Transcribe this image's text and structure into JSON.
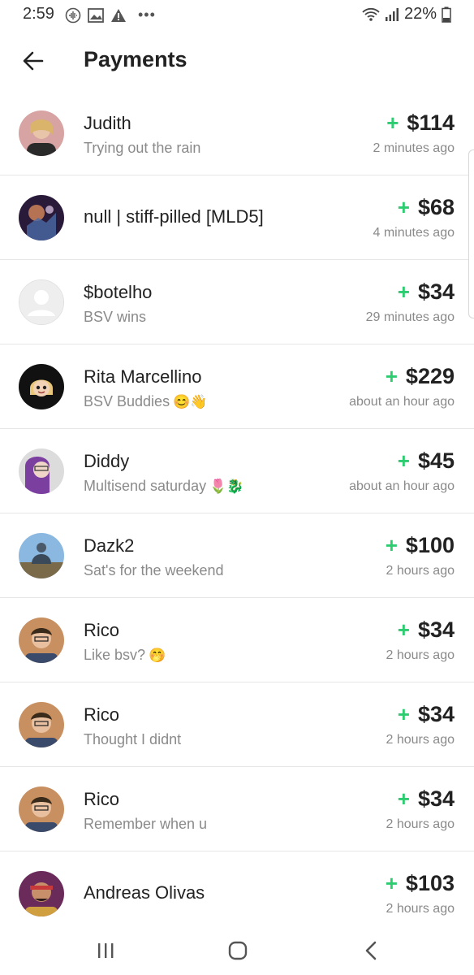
{
  "status": {
    "time": "2:59",
    "battery": "22%"
  },
  "header": {
    "title": "Payments"
  },
  "payments": [
    {
      "name": "Judith",
      "memo": "Trying out the rain",
      "amount": "$114",
      "time": "2 minutes ago",
      "avatar_color": "#c98a8a"
    },
    {
      "name": "null | stiff-pilled [MLD5]",
      "memo": "",
      "amount": "$68",
      "time": "4 minutes ago",
      "avatar_color": "#3a2a4a"
    },
    {
      "name": "$botelho",
      "memo": "BSV wins",
      "amount": "$34",
      "time": "29 minutes ago",
      "avatar_color": "#e8e8e8"
    },
    {
      "name": "Rita Marcellino",
      "memo": "BSV Buddies",
      "memo_emoji": "😊👋",
      "amount": "$229",
      "time": "about an hour ago",
      "avatar_color": "#111111"
    },
    {
      "name": "Diddy",
      "memo": "Multisend saturday",
      "memo_emoji": "🌷🐉",
      "amount": "$45",
      "time": "about an hour ago",
      "avatar_color": "#7b3fa0"
    },
    {
      "name": "Dazk2",
      "memo": "Sat's for the weekend",
      "amount": "$100",
      "time": "2 hours ago",
      "avatar_color": "#4a78a8"
    },
    {
      "name": "Rico",
      "memo": "Like bsv?",
      "memo_emoji": "🤭",
      "amount": "$34",
      "time": "2 hours ago",
      "avatar_color": "#b07a4a"
    },
    {
      "name": "Rico",
      "memo": "Thought I didnt",
      "amount": "$34",
      "time": "2 hours ago",
      "avatar_color": "#b07a4a"
    },
    {
      "name": "Rico",
      "memo": "Remember when u",
      "amount": "$34",
      "time": "2 hours ago",
      "avatar_color": "#b07a4a"
    },
    {
      "name": "Andreas Olivas",
      "memo": "",
      "amount": "$103",
      "time": "2 hours ago",
      "avatar_color": "#7a2a3a"
    }
  ],
  "accent_color": "#2ecc71"
}
